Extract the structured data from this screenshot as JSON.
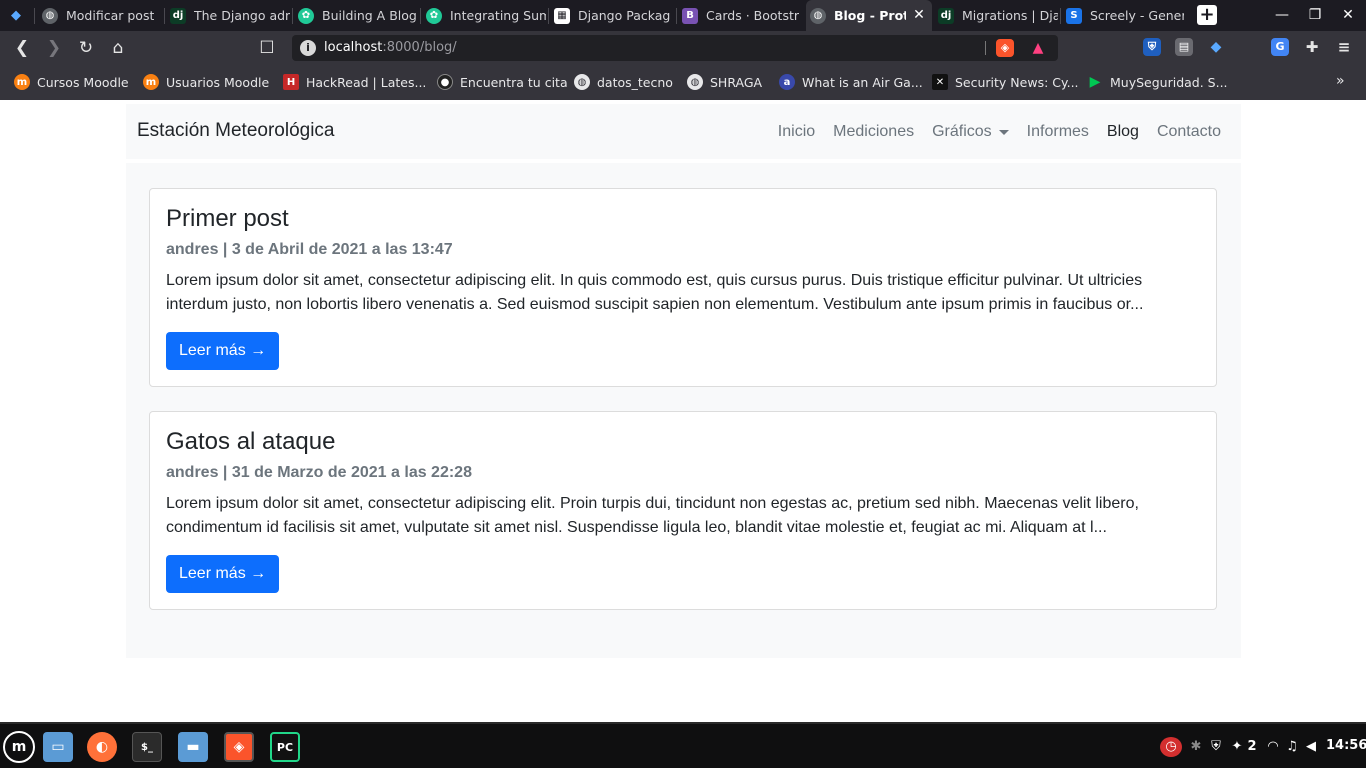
{
  "browser": {
    "tabs": [
      {
        "title": "",
        "icon": "brave-diamond-icon",
        "color": "#1a73e8"
      },
      {
        "title": "Modificar post",
        "icon": "globe-icon",
        "color": "#5f6368"
      },
      {
        "title": "The Django adm",
        "icon": "django-icon",
        "color": "#0c3c26"
      },
      {
        "title": "Building A Blog",
        "icon": "python-icon",
        "color": "#20c997"
      },
      {
        "title": "Integrating Sum",
        "icon": "python-icon",
        "color": "#20c997"
      },
      {
        "title": "Django Packag",
        "icon": "grid-icon",
        "color": "#ffffff"
      },
      {
        "title": "Cards · Bootstr",
        "icon": "bootstrap-icon",
        "color": "#7952b3"
      },
      {
        "title": "Blog - Proto",
        "icon": "globe-icon",
        "color": "#5f6368"
      },
      {
        "title": "Migrations | Dja",
        "icon": "django-icon",
        "color": "#0c3c26"
      },
      {
        "title": "Screely - Gener",
        "icon": "screely-icon",
        "color": "#1a73e8"
      }
    ],
    "url_host": "localhost",
    "url_path": ":8000/blog/",
    "bookmarks": [
      {
        "label": "Cursos Moodle",
        "icon": "moodle-icon",
        "color": "#f98012"
      },
      {
        "label": "Usuarios Moodle",
        "icon": "moodle-icon",
        "color": "#f98012"
      },
      {
        "label": "HackRead | Lates...",
        "icon": "hackread-icon",
        "color": "#c62828"
      },
      {
        "label": "Encuentra tu cita",
        "icon": "circle-icon",
        "color": "#222222"
      },
      {
        "label": "datos_tecno",
        "icon": "globe-icon",
        "color": "#5f6368"
      },
      {
        "label": "SHRAGA",
        "icon": "globe-icon",
        "color": "#5f6368"
      },
      {
        "label": "What is an Air Ga...",
        "icon": "airgap-icon",
        "color": "#3949ab"
      },
      {
        "label": "Security News: Cy...",
        "icon": "security-news-icon",
        "color": "#111111"
      },
      {
        "label": "MuySeguridad. S...",
        "icon": "flag-icon",
        "color": "#00c853"
      }
    ]
  },
  "site": {
    "brand": "Estación Meteorológica",
    "nav": {
      "inicio": "Inicio",
      "mediciones": "Mediciones",
      "graficos": "Gráficos",
      "informes": "Informes",
      "blog": "Blog",
      "contacto": "Contacto"
    }
  },
  "posts": [
    {
      "title": "Primer post",
      "meta": "andres | 3 de Abril de 2021 a las 13:47",
      "excerpt": "Lorem ipsum dolor sit amet, consectetur adipiscing elit. In quis commodo est, quis cursus purus. Duis tristique efficitur pulvinar. Ut ultricies interdum justo, non lobortis libero venenatis a. Sed euismod suscipit sapien non elementum. Vestibulum ante ipsum primis in faucibus or...",
      "button": "Leer más →"
    },
    {
      "title": "Gatos al ataque",
      "meta": "andres | 31 de Marzo de 2021 a las 22:28",
      "excerpt": "Lorem ipsum dolor sit amet, consectetur adipiscing elit. Proin turpis dui, tincidunt non egestas ac, pretium sed nibh. Maecenas velit libero, condimentum id facilisis sit amet, vulputate sit amet nisl. Suspendisse ligula leo, blandit vitae molestie et, feugiat ac mi. Aliquam at l...",
      "button": "Leer más →"
    }
  ],
  "taskbar": {
    "notification_count": "2",
    "clock": "14:56"
  },
  "colors": {
    "primary": "#0d6efd",
    "navbar_bg": "#f8f9fa",
    "muted": "#6c757d"
  }
}
